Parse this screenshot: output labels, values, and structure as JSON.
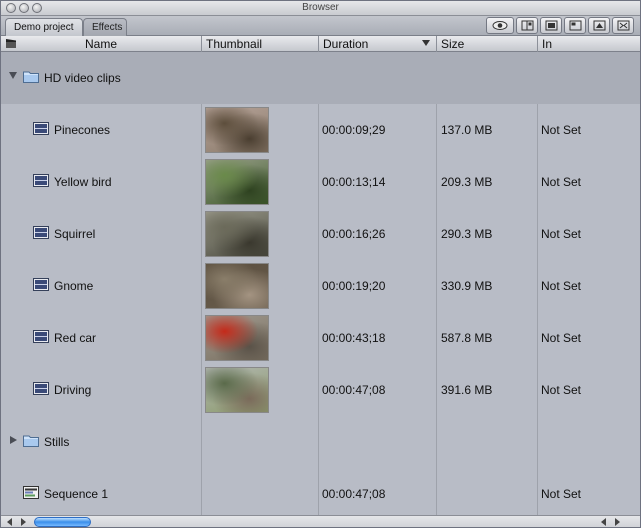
{
  "window": {
    "title": "Browser"
  },
  "tabs": [
    {
      "label": "Demo project"
    },
    {
      "label": "Effects"
    }
  ],
  "toolbar_icons": [
    "eye-icon",
    "view-columns-icon",
    "large-icons-icon",
    "medium-icons-icon",
    "small-icons-icon",
    "layout-icon"
  ],
  "columns": {
    "name": "Name",
    "thumbnail": "Thumbnail",
    "duration": "Duration",
    "size": "Size",
    "in": "In"
  },
  "rows": [
    {
      "kind": "folder",
      "expanded": true,
      "name": "HD video clips",
      "duration": "",
      "size": "",
      "in": ""
    },
    {
      "kind": "clip",
      "name": "Pinecones",
      "duration": "00:00:09;29",
      "size": "137.0 MB",
      "in": "Not Set",
      "thumb_colors": [
        "#8a7a6a",
        "#5d4e3c",
        "#b7a49a",
        "#4a3e30"
      ]
    },
    {
      "kind": "clip",
      "name": "Yellow bird",
      "duration": "00:00:13;14",
      "size": "209.3 MB",
      "in": "Not Set",
      "thumb_colors": [
        "#3e5a2a",
        "#6a8a4a",
        "#9aa08c",
        "#2e4220"
      ]
    },
    {
      "kind": "clip",
      "name": "Squirrel",
      "duration": "00:00:16;26",
      "size": "290.3 MB",
      "in": "Not Set",
      "thumb_colors": [
        "#4a4a3e",
        "#6b6a5a",
        "#9b9a8c",
        "#3a382e"
      ]
    },
    {
      "kind": "clip",
      "name": "Gnome",
      "duration": "00:00:19;20",
      "size": "330.9 MB",
      "in": "Not Set",
      "thumb_colors": [
        "#6a5e4e",
        "#8a7e6a",
        "#5a4e3e",
        "#a49482"
      ]
    },
    {
      "kind": "clip",
      "name": "Red car",
      "duration": "00:00:43;18",
      "size": "587.8 MB",
      "in": "Not Set",
      "thumb_colors": [
        "#7a7060",
        "#c42a1a",
        "#a09a90",
        "#5a5248"
      ]
    },
    {
      "kind": "clip",
      "name": "Driving",
      "duration": "00:00:47;08",
      "size": "391.6 MB",
      "in": "Not Set",
      "thumb_colors": [
        "#8a9a6a",
        "#5a6a4a",
        "#b4b8b4",
        "#7a6a5a"
      ]
    },
    {
      "kind": "folder",
      "expanded": false,
      "name": "Stills",
      "duration": "",
      "size": "",
      "in": ""
    },
    {
      "kind": "sequence",
      "name": "Sequence 1",
      "duration": "00:00:47;08",
      "size": "",
      "in": "Not Set"
    }
  ]
}
